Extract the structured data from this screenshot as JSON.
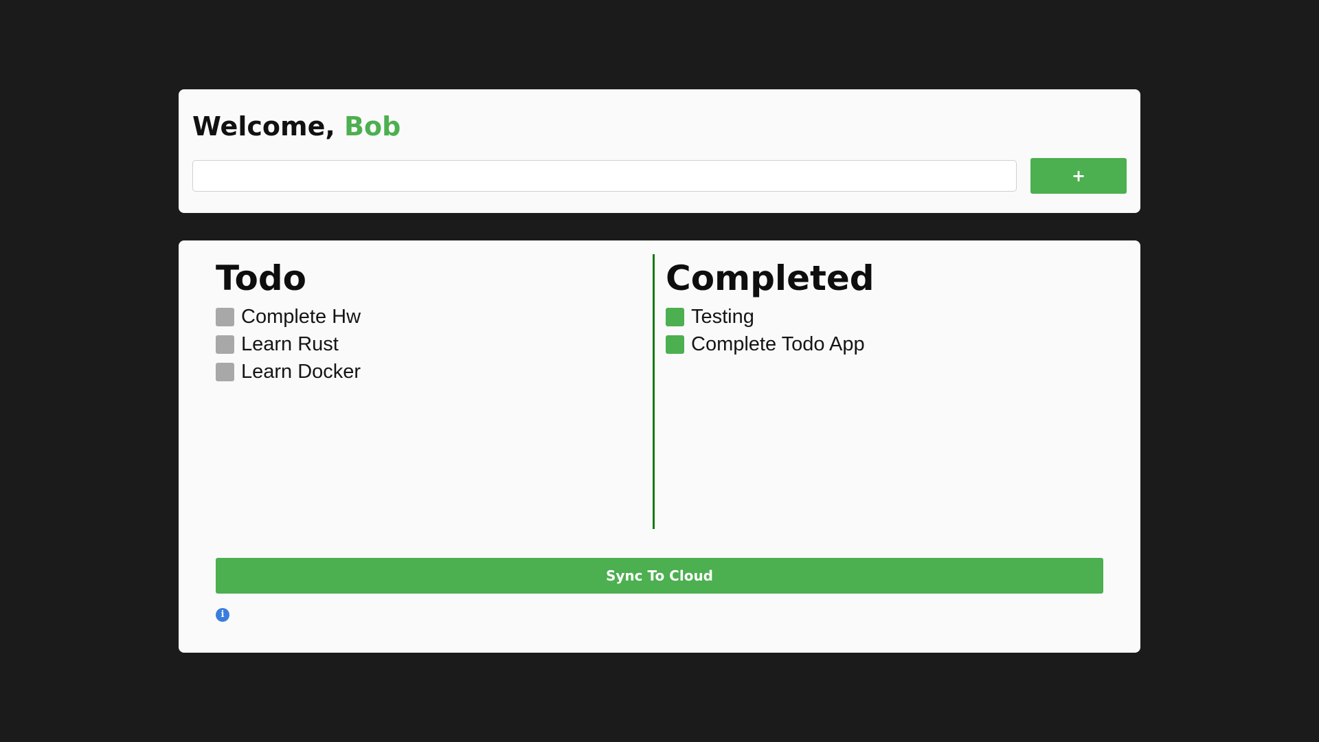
{
  "header": {
    "welcome_prefix": "Welcome, ",
    "user_name": "Bob"
  },
  "new_task": {
    "value": "",
    "add_label": "+"
  },
  "todo": {
    "title": "Todo",
    "items": [
      {
        "label": "Complete Hw"
      },
      {
        "label": "Learn Rust"
      },
      {
        "label": "Learn Docker"
      }
    ]
  },
  "completed": {
    "title": "Completed",
    "items": [
      {
        "label": "Testing"
      },
      {
        "label": "Complete Todo App"
      }
    ]
  },
  "sync_label": "Sync To Cloud",
  "icons": {
    "info": "info-icon",
    "info_glyph": "i"
  },
  "colors": {
    "accent": "#4caf50",
    "background": "#1b1b1b",
    "card": "#fafafa",
    "unchecked": "#a8a8a8",
    "divider": "#137a13",
    "info": "#3b7ddd"
  }
}
